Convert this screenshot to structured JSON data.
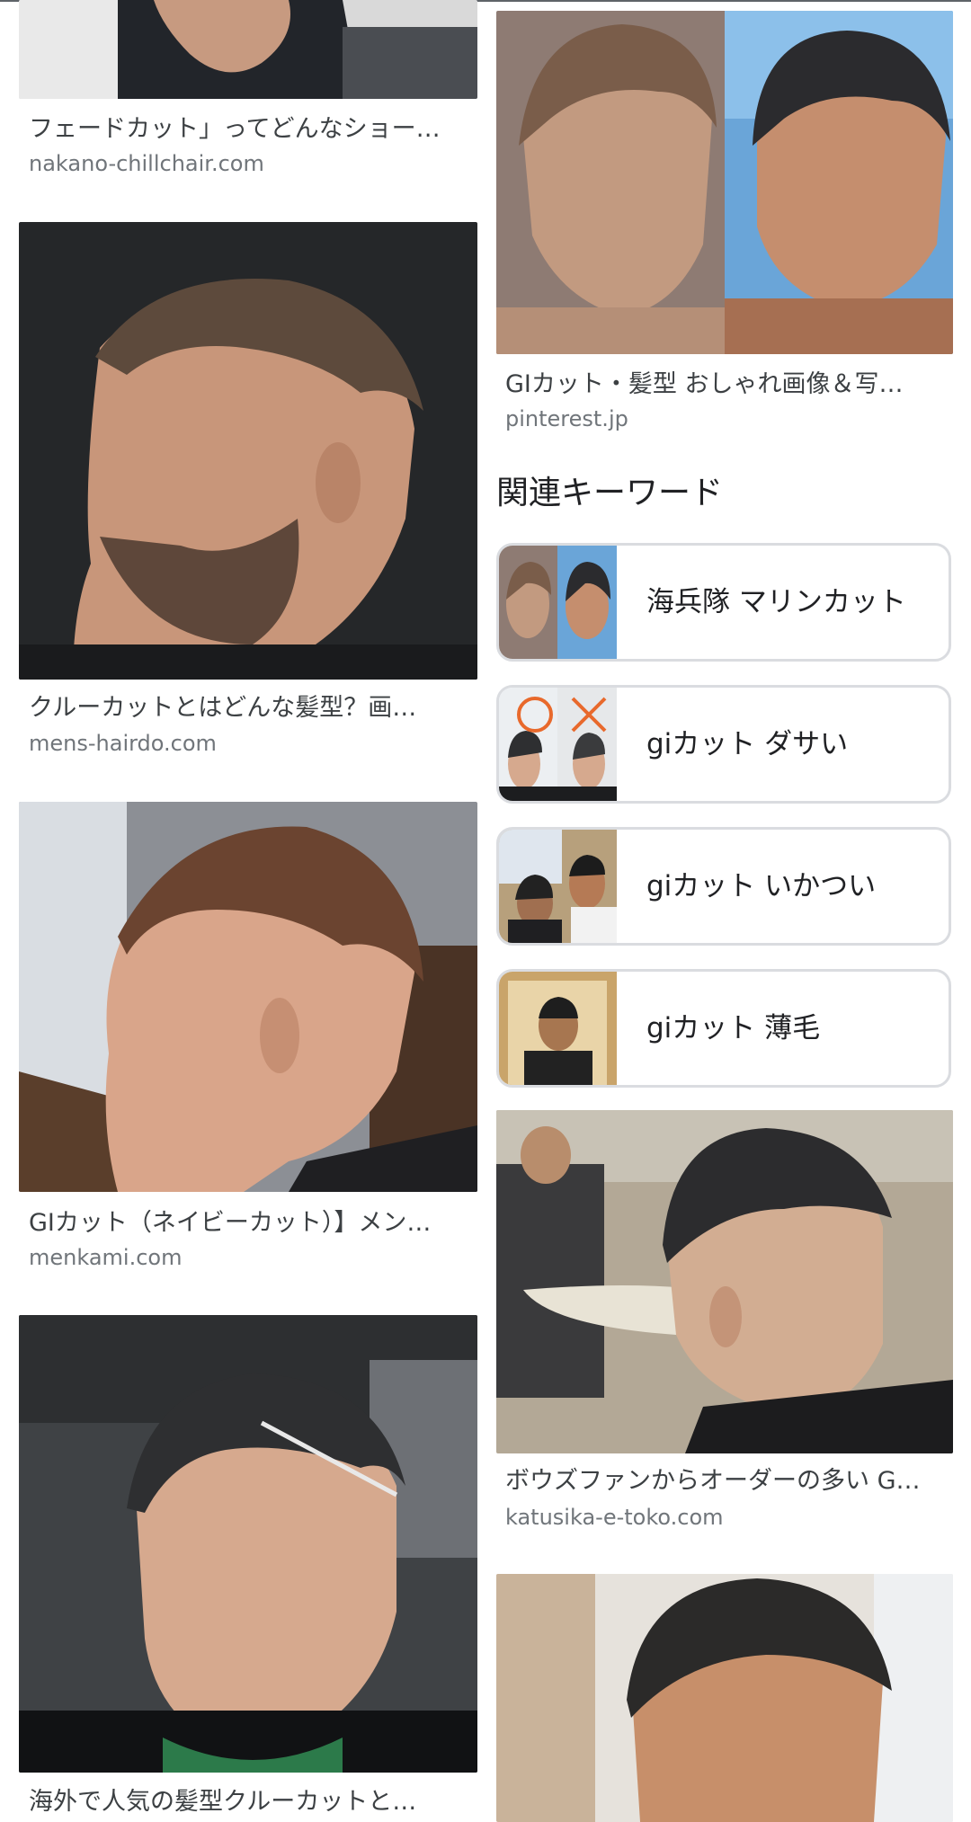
{
  "results_left": [
    {
      "title": "フェードカット」ってどんなショー…",
      "domain": "nakano-chillchair.com"
    },
    {
      "title": "クルーカットとはどんな髪型？画…",
      "domain": "mens-hairdo.com"
    },
    {
      "title": "GIカット（ネイビーカット）】メン…",
      "domain": "menkami.com"
    },
    {
      "title": "海外で人気の髪型クルーカットと…",
      "domain": ""
    }
  ],
  "results_right": [
    {
      "title": "GIカット・髪型 おしゃれ画像＆写…",
      "domain": "pinterest.jp"
    },
    {
      "title": "ボウズファンからオーダーの多い G…",
      "domain": "katusika-e-toko.com"
    }
  ],
  "related": {
    "heading": "関連キーワード",
    "items": [
      {
        "label": "海兵隊 マリンカット",
        "icon": "haircut-thumbnail"
      },
      {
        "label": "giカット ダサい",
        "icon": "haircut-thumbnail-with-circle-and-cross"
      },
      {
        "label": "giカット いかつい",
        "icon": "haircut-thumbnail"
      },
      {
        "label": "giカット 薄毛",
        "icon": "haircut-thumbnail"
      }
    ]
  },
  "colors": {
    "accent_marks": "#e8692c",
    "card_border": "#dadce0"
  }
}
